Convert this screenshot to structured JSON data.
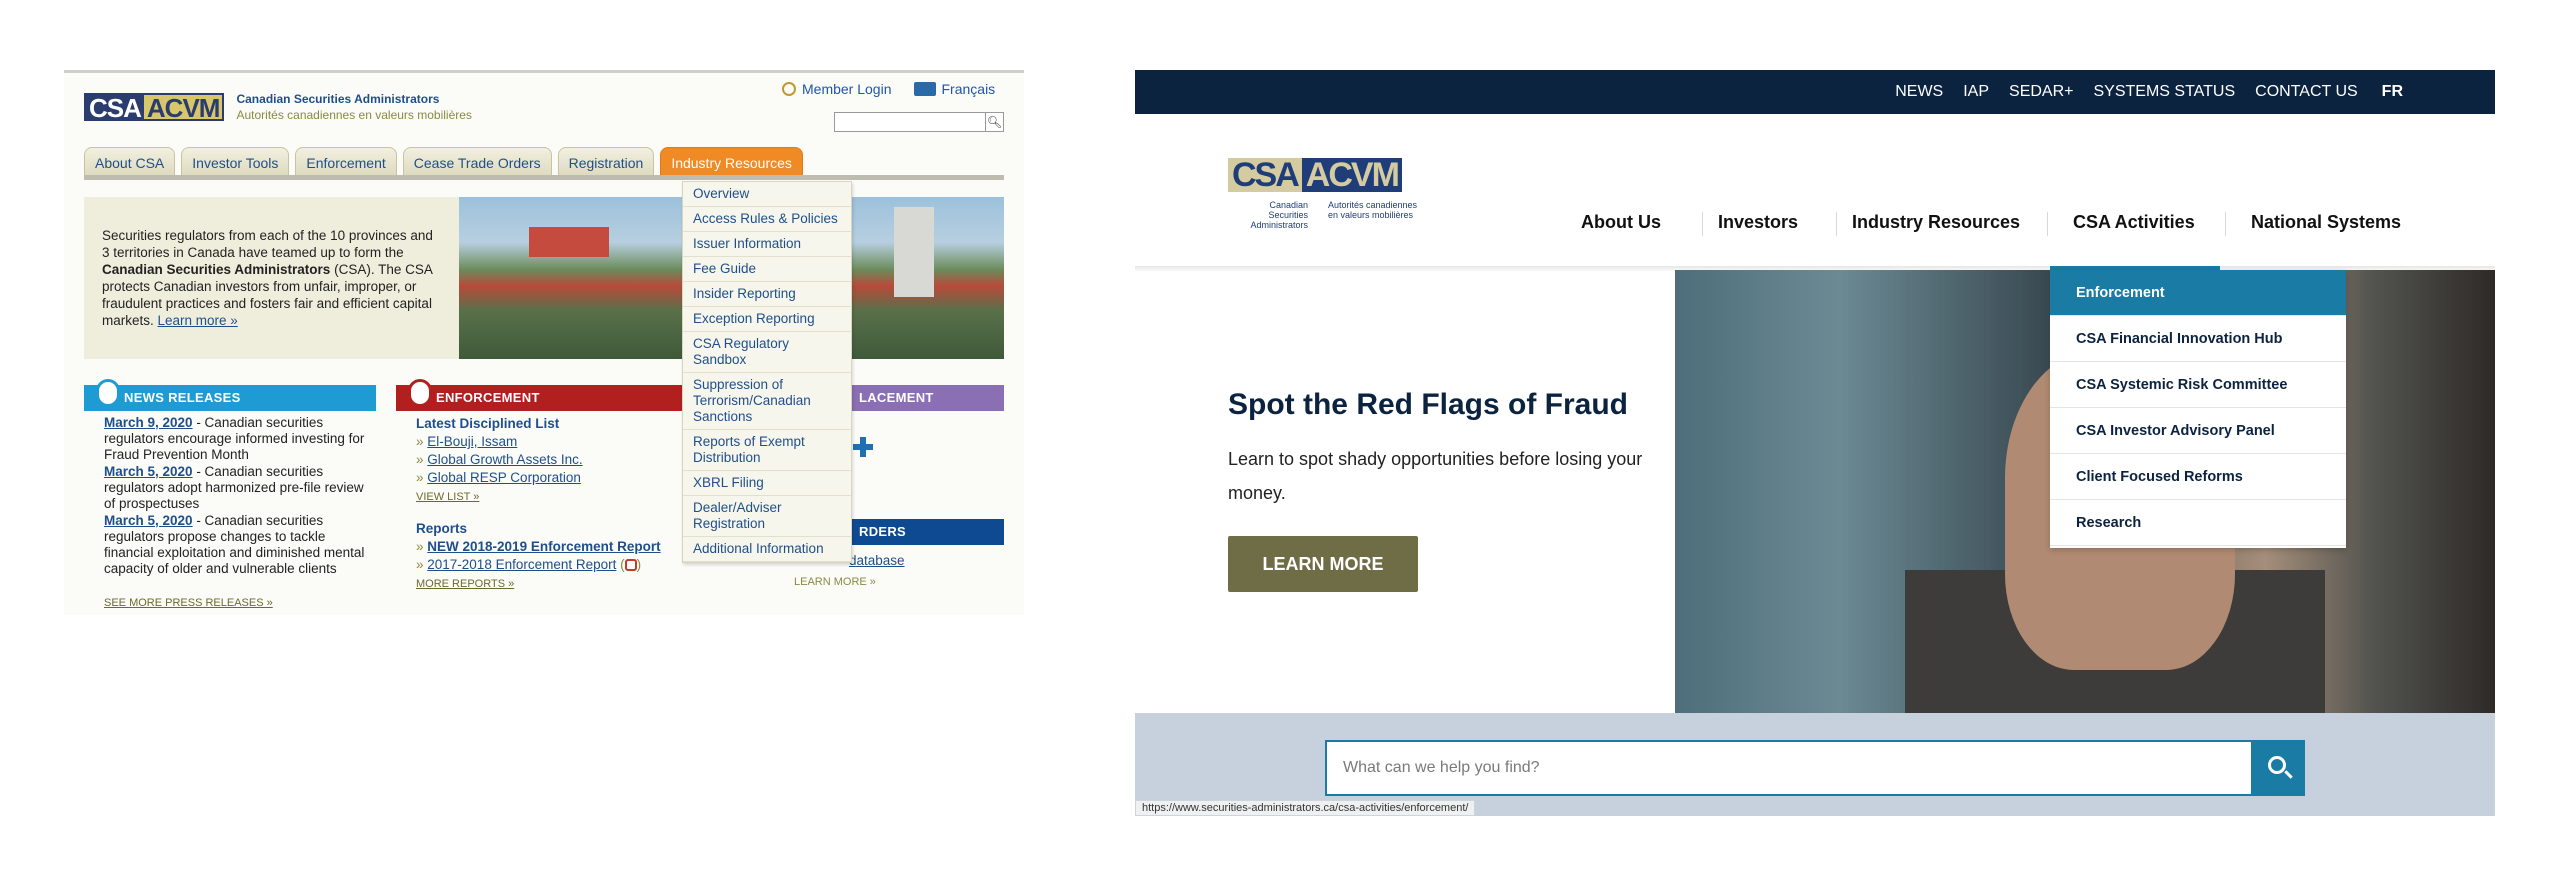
{
  "old_site": {
    "logo": {
      "part_a": "CSA",
      "part_b": "ACVM"
    },
    "org_name_en": "Canadian Securities Administrators",
    "org_name_fr": "Autorités canadiennes en valeurs mobilières",
    "member_login": "Member Login",
    "language_link": "Français",
    "tabs": [
      {
        "label": "About CSA"
      },
      {
        "label": "Investor Tools"
      },
      {
        "label": "Enforcement"
      },
      {
        "label": "Cease Trade Orders"
      },
      {
        "label": "Registration"
      },
      {
        "label": "Industry Resources"
      }
    ],
    "intro": {
      "text_1": "Securities regulators from each of the 10 provinces and 3 territories in Canada have teamed up to form the ",
      "bold": "Canadian Securities Administrators",
      "text_2": " (CSA). The CSA protects Canadian investors from unfair, improper, or fraudulent practices and fosters fair and efficient capital markets. ",
      "link": "Learn more »"
    },
    "news": {
      "heading": "NEWS RELEASES",
      "items": [
        {
          "date": "March 9, 2020",
          "text": " - Canadian securities regulators encourage informed investing for Fraud Prevention Month"
        },
        {
          "date": "March 5, 2020",
          "text": " - Canadian securities regulators adopt harmonized pre-file review of prospectuses"
        },
        {
          "date": "March 5, 2020",
          "text": " - Canadian securities regulators propose changes to tackle financial exploitation and diminished mental capacity of older and vulnerable clients"
        }
      ],
      "see_more": "SEE MORE PRESS RELEASES »"
    },
    "enforcement": {
      "heading": "ENFORCEMENT",
      "list_title": "Latest Disciplined List",
      "items": [
        "El-Bouji, Issam",
        "Global Growth Assets Inc.",
        "Global RESP Corporation"
      ],
      "view_list": "VIEW LIST »",
      "reports_title": "Reports",
      "reports": [
        "NEW 2018-2019 Enforcement Report",
        "2017-2018 Enforcement Report"
      ],
      "more_reports": "MORE REPORTS »"
    },
    "purple_heading": "LACEMENT",
    "orders_heading": "RDERS",
    "database_link": "database",
    "learn_more_clipped": "LEARN MORE »",
    "dropdown_items": [
      "Overview",
      "Access Rules & Policies",
      "Issuer Information",
      "Fee Guide",
      "Insider Reporting",
      "Exception Reporting",
      "CSA Regulatory Sandbox",
      "Suppression of Terrorism/Canadian Sanctions",
      "Reports of Exempt Distribution",
      "XBRL Filing",
      "Dealer/Adviser Registration",
      "Additional Information"
    ]
  },
  "new_site": {
    "topbar": [
      "NEWS",
      "IAP",
      "SEDAR+",
      "SYSTEMS STATUS",
      "CONTACT US"
    ],
    "topbar_lang": "FR",
    "logo": {
      "part_a": "CSA",
      "part_b": "ACVM",
      "sub_en": "Canadian Securities Administrators",
      "sub_fr": "Autorités canadiennes en valeurs mobilières"
    },
    "nav": [
      "About Us",
      "Investors",
      "Industry Resources",
      "CSA Activities",
      "National Systems"
    ],
    "submenu": [
      "Enforcement",
      "CSA Financial Innovation Hub",
      "CSA Systemic Risk Committee",
      "CSA Investor Advisory Panel",
      "Client Focused Reforms",
      "Research"
    ],
    "hero": {
      "title": "Spot the Red Flags of Fraud",
      "subtitle": "Learn to spot shady opportunities before losing your money.",
      "button": "LEARN MORE"
    },
    "search_placeholder": "What can we help you find?",
    "status_url": "https://www.securities-administrators.ca/csa-activities/enforcement/"
  }
}
